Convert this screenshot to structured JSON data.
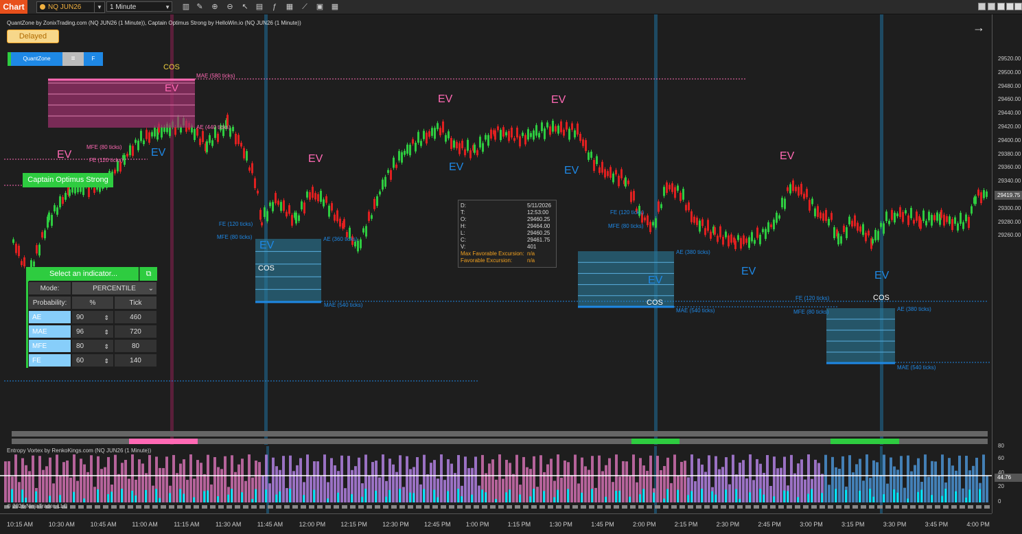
{
  "toolbar": {
    "chart_tab": "Chart",
    "symbol": "NQ JUN26",
    "timeframe": "1 Minute"
  },
  "chart_title": "QuantZone by ZonixTrading.com (NQ JUN26 (1 Minute)), Captain Optimus Strong by HelloWin.io (NQ JUN26 (1 Minute))",
  "delayed_label": "Delayed",
  "quantzone_bar": {
    "quantzone": "QuantZone",
    "menu": "≡",
    "f": "F"
  },
  "captain_label": "Captain Optimus Strong",
  "corner_f": "F",
  "indicator_panel": {
    "header": "Select an indicator...",
    "mode_label": "Mode:",
    "mode_value": "PERCENTILE",
    "prob_label": "Probability:",
    "pct_header": "%",
    "tick_header": "Tick",
    "rows": [
      {
        "name": "AE",
        "pct": "90",
        "tick": "460"
      },
      {
        "name": "MAE",
        "pct": "96",
        "tick": "720"
      },
      {
        "name": "MFE",
        "pct": "80",
        "tick": "80"
      },
      {
        "name": "FE",
        "pct": "60",
        "tick": "140"
      }
    ]
  },
  "info_box": {
    "rows": [
      {
        "k": "D:",
        "v": "5/11/2026"
      },
      {
        "k": "T:",
        "v": "12:53:00"
      },
      {
        "k": "O:",
        "v": "29460.25"
      },
      {
        "k": "H:",
        "v": "29464.00"
      },
      {
        "k": "L:",
        "v": "29460.25"
      },
      {
        "k": "C:",
        "v": "29461.75"
      },
      {
        "k": "V:",
        "v": "401"
      },
      {
        "k": "Max Favorable Excursion:",
        "v": "n/a"
      },
      {
        "k": "Favorable Excursion:",
        "v": "n/a"
      }
    ]
  },
  "price_axis": [
    "29520.00",
    "29500.00",
    "29480.00",
    "29460.00",
    "29440.00",
    "29420.00",
    "29400.00",
    "29380.00",
    "29360.00",
    "29340.00",
    "29320.00",
    "29300.00",
    "29280.00",
    "29260.00"
  ],
  "current_price": "29419.75",
  "time_axis": [
    "10:15 AM",
    "10:30 AM",
    "10:45 AM",
    "11:00 AM",
    "11:15 AM",
    "11:30 AM",
    "11:45 AM",
    "12:00 PM",
    "12:15 PM",
    "12:30 PM",
    "12:45 PM",
    "1:00 PM",
    "1:15 PM",
    "1:30 PM",
    "1:45 PM",
    "2:00 PM",
    "2:15 PM",
    "2:30 PM",
    "2:45 PM",
    "3:00 PM",
    "3:15 PM",
    "3:30 PM",
    "3:45 PM",
    "4:00 PM"
  ],
  "sub_title": "Entropy Vortex by RenkoKings.com (NQ JUN26 (1 Minute))",
  "sub_axis": [
    "60",
    "40",
    "20",
    "0",
    "80"
  ],
  "sub_current": "44.76",
  "copyright": "© 2026 NinjaTrader, LLC",
  "annotations": {
    "cos": "COS",
    "ev": "EV",
    "mae_580": "MAE (580 ticks)",
    "ae_440": "AE (440 ticks)",
    "mfe_80": "MFE (80 ticks)",
    "fe_120": "FE (120 ticks)",
    "ae_360": "AE (360 ticks)",
    "mae_540": "MAE (540 ticks)",
    "ae_380": "AE (380 ticks)"
  },
  "colors": {
    "bull": "#2ecc40",
    "bear": "#e02020",
    "pink": "#ff69b4",
    "blue": "#1e88e5",
    "accent": "#e8501c"
  }
}
